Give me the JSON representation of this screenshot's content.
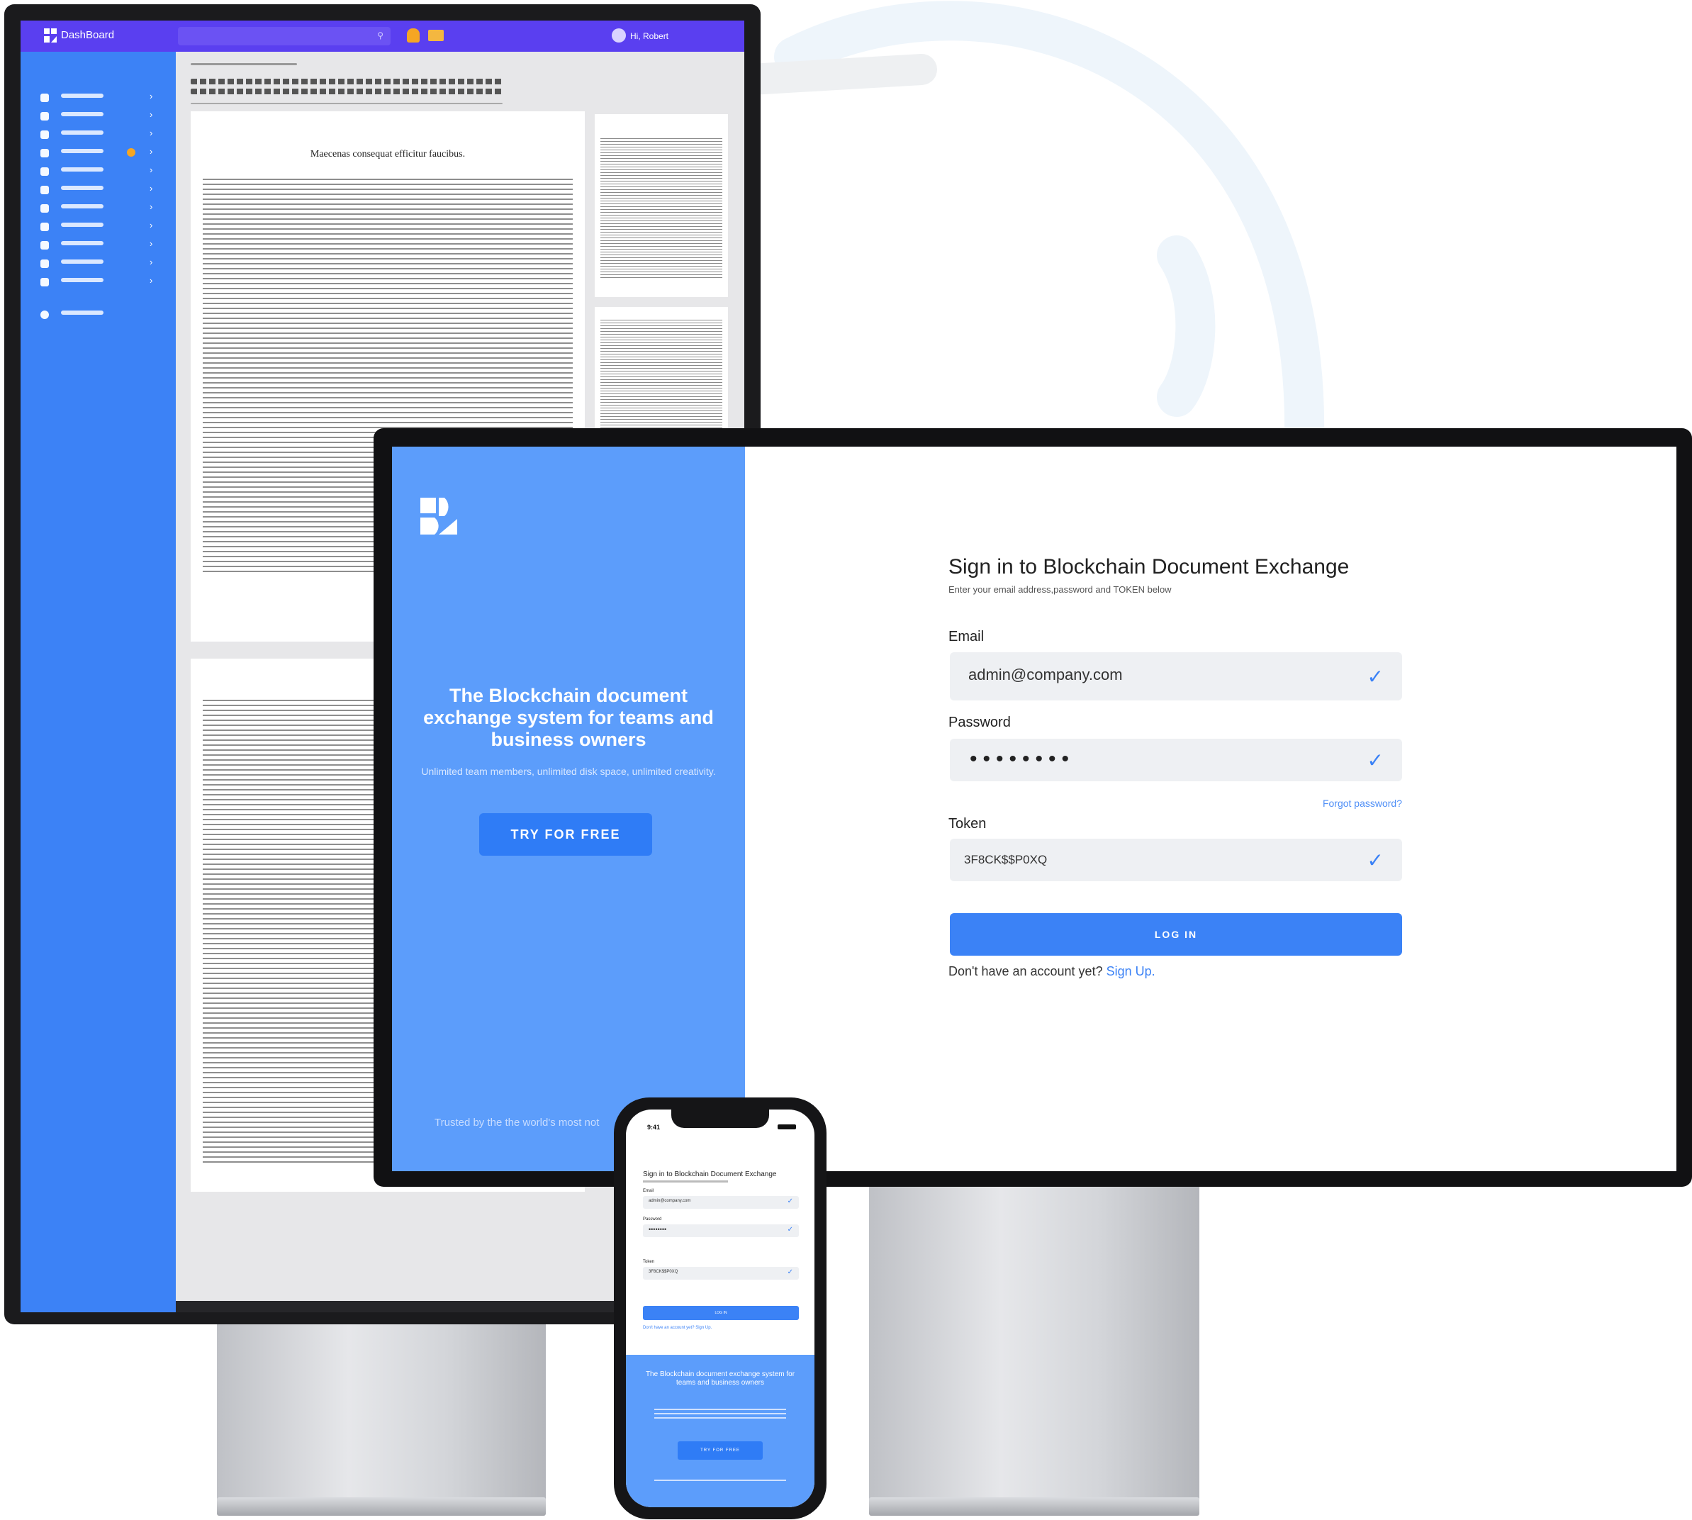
{
  "dashboard": {
    "app_title": "DashBoard",
    "user_greeting": "Hi, Robert",
    "document_title": "Maecenas consequat efficitur faucibus."
  },
  "signin": {
    "title": "Sign in to Blockchain Document Exchange",
    "subtitle": "Enter your email address,password and TOKEN below",
    "email_label": "Email",
    "email_value": "admin@company.com",
    "password_label": "Password",
    "password_value": "••••••••",
    "forgot_label": "Forgot password?",
    "token_label": "Token",
    "token_value": "3F8CK$$P0XQ",
    "login_label": "LOG IN",
    "signup_prompt": "Don't have an account yet?",
    "signup_link": "Sign Up."
  },
  "hero": {
    "title": "The Blockchain document exchange system for teams and business owners",
    "subtitle": "Unlimited team members, unlimited disk space, unlimited creativity.",
    "cta_label": "TRY FOR FREE",
    "trusted_text": "Trusted by the the world's most not"
  },
  "phone": {
    "time": "9:41",
    "title": "Sign in to Blockchain Document Exchange",
    "email_label": "Email",
    "email_value": "admin@company.com",
    "password_label": "Password",
    "password_value": "••••••••",
    "token_label": "Token",
    "token_value": "3F8CK$$P0XQ",
    "login_label": "LOG IN",
    "signup_prompt": "Don't have an account yet?",
    "signup_link": "Sign Up.",
    "hero_title": "The Blockchain document exchange system for teams and business owners",
    "cta_label": "TRY FOR FREE"
  },
  "colors": {
    "accent_blue": "#3b82f6",
    "hero_blue": "#5c9dfb",
    "dashboard_purple": "#5a3ff0"
  }
}
